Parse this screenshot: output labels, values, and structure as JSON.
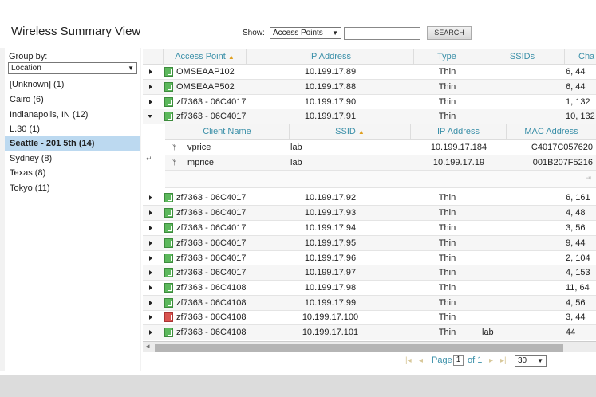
{
  "header": {
    "title": "Wireless Summary View",
    "show_label": "Show:",
    "show_value": "Access Points",
    "search_value": "",
    "search_button": "SEARCH"
  },
  "sidebar": {
    "group_by_label": "Group by:",
    "group_by_value": "Location",
    "items": [
      {
        "label": "[Unknown] (1)"
      },
      {
        "label": "Cairo (6)"
      },
      {
        "label": "Indianapolis, IN (12)"
      },
      {
        "label": "L.30 (1)"
      },
      {
        "label": "Seattle - 201 5th (14)"
      },
      {
        "label": "Sydney (8)"
      },
      {
        "label": "Texas (8)"
      },
      {
        "label": "Tokyo (11)"
      }
    ],
    "active_index": 4
  },
  "grid": {
    "columns": [
      "Access Point",
      "IP Address",
      "Type",
      "SSIDs",
      "Cha"
    ],
    "rows": [
      {
        "ap": "OMSEAAP102",
        "ip": "10.199.17.89",
        "type": "Thin",
        "ssids": "",
        "ch": "6, 44",
        "status": "green"
      },
      {
        "ap": "OMSEAAP502",
        "ip": "10.199.17.88",
        "type": "Thin",
        "ssids": "",
        "ch": "6, 44",
        "status": "green"
      },
      {
        "ap": "zf7363 - 06C4017",
        "ip": "10.199.17.90",
        "type": "Thin",
        "ssids": "",
        "ch": "1, 132",
        "status": "green"
      },
      {
        "ap": "zf7363 - 06C4017",
        "ip": "10.199.17.91",
        "type": "Thin",
        "ssids": "",
        "ch": "10, 132",
        "status": "green"
      },
      {
        "ap": "zf7363 - 06C4017",
        "ip": "10.199.17.92",
        "type": "Thin",
        "ssids": "",
        "ch": "6, 161",
        "status": "green"
      },
      {
        "ap": "zf7363 - 06C4017",
        "ip": "10.199.17.93",
        "type": "Thin",
        "ssids": "",
        "ch": "4, 48",
        "status": "green"
      },
      {
        "ap": "zf7363 - 06C4017",
        "ip": "10.199.17.94",
        "type": "Thin",
        "ssids": "",
        "ch": "3, 56",
        "status": "green"
      },
      {
        "ap": "zf7363 - 06C4017",
        "ip": "10.199.17.95",
        "type": "Thin",
        "ssids": "",
        "ch": "9, 44",
        "status": "green"
      },
      {
        "ap": "zf7363 - 06C4017",
        "ip": "10.199.17.96",
        "type": "Thin",
        "ssids": "",
        "ch": "2, 104",
        "status": "green"
      },
      {
        "ap": "zf7363 - 06C4017",
        "ip": "10.199.17.97",
        "type": "Thin",
        "ssids": "",
        "ch": "4, 153",
        "status": "green"
      },
      {
        "ap": "zf7363 - 06C4108",
        "ip": "10.199.17.98",
        "type": "Thin",
        "ssids": "",
        "ch": "11, 64",
        "status": "green"
      },
      {
        "ap": "zf7363 - 06C4108",
        "ip": "10.199.17.99",
        "type": "Thin",
        "ssids": "",
        "ch": "4, 56",
        "status": "green"
      },
      {
        "ap": "zf7363 - 06C4108",
        "ip": "10.199.17.100",
        "type": "Thin",
        "ssids": "",
        "ch": "3, 44",
        "status": "red"
      },
      {
        "ap": "zf7363 - 06C4108",
        "ip": "10.199.17.101",
        "type": "Thin",
        "ssids": "lab",
        "ch": "44",
        "status": "green"
      }
    ],
    "expanded_row_index": 3
  },
  "clients": {
    "columns": [
      "Client Name",
      "SSID",
      "IP Address",
      "MAC Address"
    ],
    "rows": [
      {
        "name": "vprice",
        "ssid": "lab",
        "ip": "10.199.17.184",
        "mac": "C4017C057620"
      },
      {
        "name": "mprice",
        "ssid": "lab",
        "ip": "10.199.17.19",
        "mac": "001B207F5216"
      }
    ]
  },
  "pager": {
    "page_label": "Page",
    "page_value": "1",
    "of_label": "of 1",
    "page_size": "30"
  },
  "colors": {
    "header_text": "#3a8fa8",
    "selection": "#bcd9f0",
    "status_ok": "#5cb85c",
    "status_error": "#d9534f"
  }
}
